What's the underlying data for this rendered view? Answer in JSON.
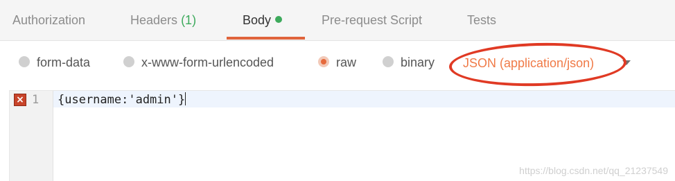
{
  "tabs": [
    {
      "label": "Authorization"
    },
    {
      "label": "Headers",
      "count": "(1)"
    },
    {
      "label": "Body",
      "active": true
    },
    {
      "label": "Pre-request Script"
    },
    {
      "label": "Tests"
    }
  ],
  "body_types": [
    {
      "label": "form-data",
      "selected": false
    },
    {
      "label": "x-www-form-urlencoded",
      "selected": false
    },
    {
      "label": "raw",
      "selected": true
    },
    {
      "label": "binary",
      "selected": false
    }
  ],
  "content_type": {
    "selected": "JSON (application/json)"
  },
  "editor": {
    "lines": [
      {
        "number": "1",
        "text": "{username:'admin'}",
        "has_error": true
      }
    ]
  },
  "watermark": "https://blog.csdn.net/qq_21237549",
  "colors": {
    "accent": "#e0643b",
    "active_dot": "#3daa5c",
    "annotation": "#e03a24",
    "json_select": "#f07a47"
  }
}
